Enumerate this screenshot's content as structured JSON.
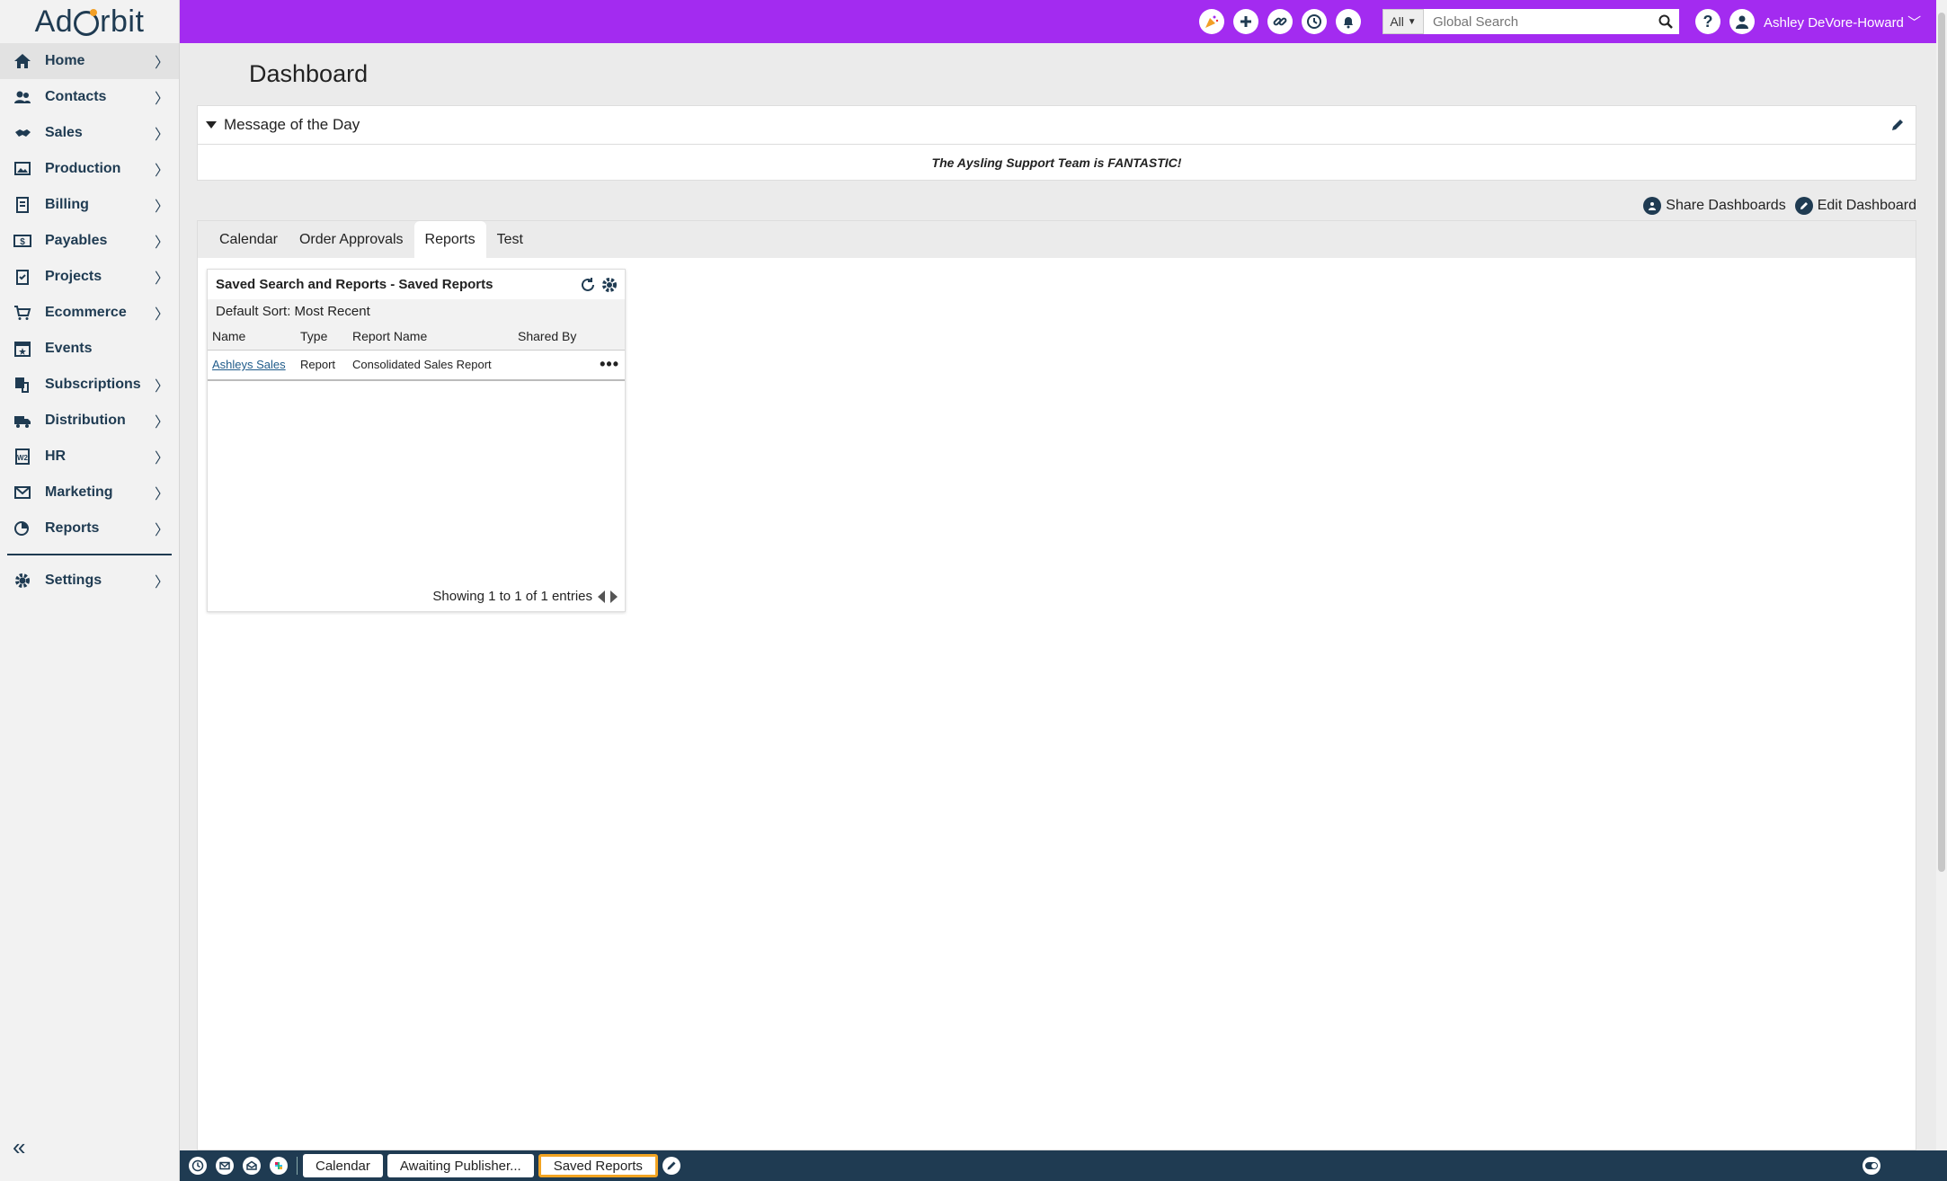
{
  "app": {
    "logo_text_left": "Ad",
    "logo_text_right": "rbit"
  },
  "sidebar": {
    "items": [
      {
        "label": "Home",
        "icon": "home-icon",
        "chevron": true,
        "active": true
      },
      {
        "label": "Contacts",
        "icon": "contacts-icon",
        "chevron": true
      },
      {
        "label": "Sales",
        "icon": "sales-icon",
        "chevron": true
      },
      {
        "label": "Production",
        "icon": "production-icon",
        "chevron": true
      },
      {
        "label": "Billing",
        "icon": "billing-icon",
        "chevron": true
      },
      {
        "label": "Payables",
        "icon": "payables-icon",
        "chevron": true
      },
      {
        "label": "Projects",
        "icon": "projects-icon",
        "chevron": true
      },
      {
        "label": "Ecommerce",
        "icon": "cart-icon",
        "chevron": true
      },
      {
        "label": "Events",
        "icon": "calendar-star-icon",
        "chevron": false
      },
      {
        "label": "Subscriptions",
        "icon": "subscriptions-icon",
        "chevron": true
      },
      {
        "label": "Distribution",
        "icon": "truck-icon",
        "chevron": true
      },
      {
        "label": "HR",
        "icon": "hr-icon",
        "chevron": true
      },
      {
        "label": "Marketing",
        "icon": "mail-icon",
        "chevron": true
      },
      {
        "label": "Reports",
        "icon": "reports-icon",
        "chevron": true
      }
    ],
    "settings": {
      "label": "Settings",
      "icon": "gear-icon"
    }
  },
  "header": {
    "search_scope": "All",
    "search_placeholder": "Global Search",
    "help": "?",
    "user_name": "Ashley DeVore-Howard",
    "accent_color": "#a32bf0"
  },
  "main": {
    "page_title": "Dashboard",
    "motd": {
      "title": "Message of the Day",
      "message": "The Aysling Support Team is FANTASTIC!"
    },
    "actions": {
      "share": "Share Dashboards",
      "edit": "Edit Dashboard"
    },
    "tabs": [
      "Calendar",
      "Order Approvals",
      "Reports",
      "Test"
    ],
    "active_tab": "Reports",
    "widget": {
      "title": "Saved Search and Reports - Saved Reports",
      "sort": "Default Sort: Most Recent",
      "columns": [
        "Name",
        "Type",
        "Report Name",
        "Shared By"
      ],
      "rows": [
        {
          "name": "Ashleys Sales",
          "type": "Report",
          "report_name": "Consolidated Sales Report",
          "shared_by": ""
        }
      ],
      "footer": "Showing 1 to 1 of 1 entries"
    }
  },
  "bottombar": {
    "tabs": [
      "Calendar",
      "Awaiting Publisher...",
      "Saved Reports"
    ],
    "active_tab": "Saved Reports",
    "bar_color": "#1f3b52"
  }
}
